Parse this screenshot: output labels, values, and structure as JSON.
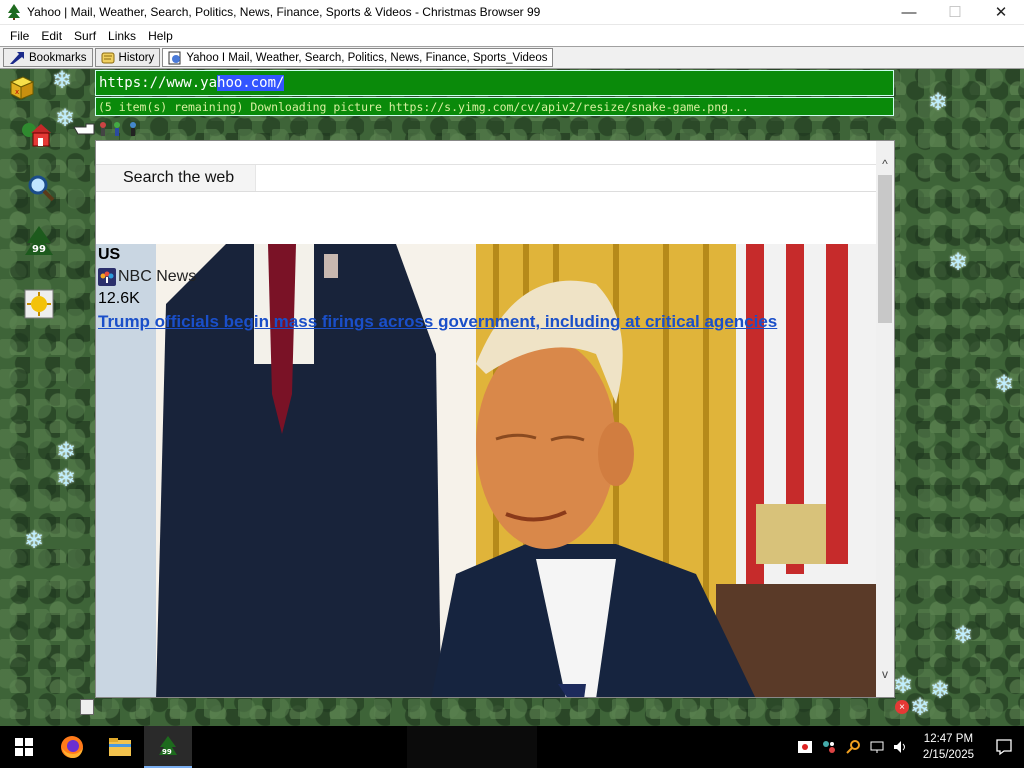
{
  "window": {
    "title": "Yahoo | Mail, Weather, Search, Politics, News, Finance, Sports & Videos - Christmas Browser 99",
    "minimize_glyph": "—",
    "maximize_glyph": "☐",
    "close_glyph": "✕"
  },
  "menu": [
    "File",
    "Edit",
    "Surf",
    "Links",
    "Help"
  ],
  "tabs": {
    "bookmarks": "Bookmarks",
    "history": "History",
    "page": "Yahoo I Mail, Weather, Search, Politics, News, Finance, Sports_Videos"
  },
  "address": {
    "url_unselected": "https://www.ya",
    "url_selected": "hoo.com/",
    "status": "(5 item(s) remaining) Downloading picture https://s.yimg.com/cv/apiv2/resize/snake-game.png..."
  },
  "page": {
    "search_label": "Search the web",
    "article": {
      "category": "US",
      "source": "NBC News",
      "count": "12.6K",
      "headline": "Trump officials begin mass firings across government, including at critical agencies"
    },
    "scroll_up": "^",
    "scroll_down": "v"
  },
  "side_icons": [
    "cube-icon",
    "home-icon",
    "magnifier-icon",
    "tree-99-icon",
    "sun-icon"
  ],
  "taskbar": {
    "time": "12:47 PM",
    "date": "2/15/2025",
    "pinned": [
      "windows-start-icon",
      "firefox-icon",
      "file-explorer-icon",
      "christmas-browser-icon"
    ]
  },
  "colors": {
    "address_bg": "#0a8a0a",
    "status_text": "#d8f0a0",
    "link": "#1a4fc9",
    "forest": "#3e6438",
    "snowflake": "#bfefff"
  }
}
